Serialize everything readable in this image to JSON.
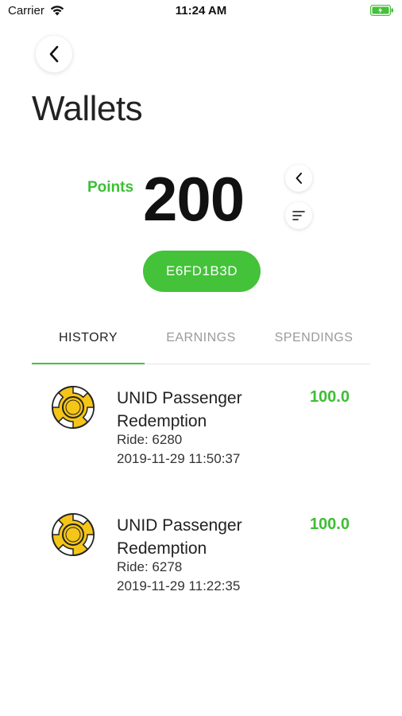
{
  "status_bar": {
    "carrier": "Carrier",
    "time": "11:24 AM",
    "battery_color": "#44c23a"
  },
  "header": {
    "back_icon": "chevron-left-icon",
    "title": "Wallets"
  },
  "points": {
    "label": "Points",
    "value": "200",
    "code": "E6FD1B3D",
    "accent": "#44c23a"
  },
  "tabs": [
    {
      "label": "HISTORY",
      "active": true
    },
    {
      "label": "EARNINGS",
      "active": false
    },
    {
      "label": "SPENDINGS",
      "active": false
    }
  ],
  "history": [
    {
      "title": "UNID Passenger Redemption",
      "ride": "Ride: 6280",
      "date": "2019-11-29 11:50:37",
      "amount": "100.0",
      "icon": "coin-icon"
    },
    {
      "title": "UNID Passenger Redemption",
      "ride": "Ride: 6278",
      "date": "2019-11-29 11:22:35",
      "amount": "100.0",
      "icon": "coin-icon"
    }
  ]
}
